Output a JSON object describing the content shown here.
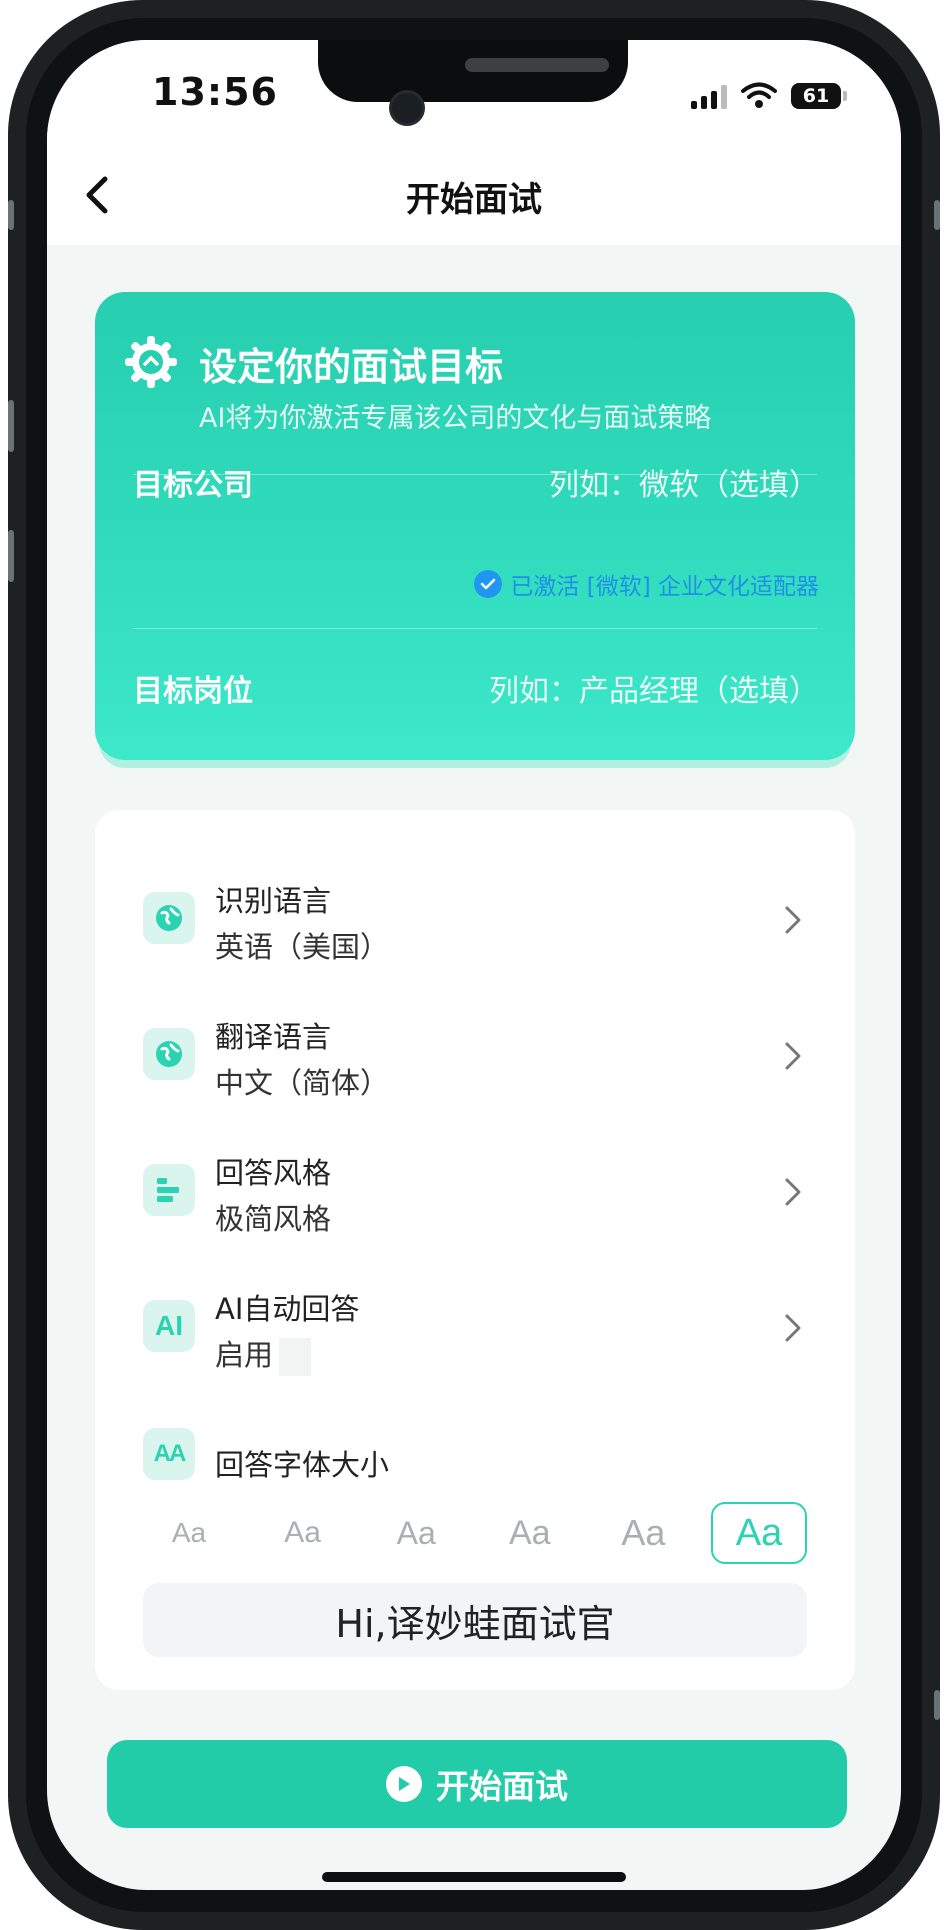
{
  "status_bar": {
    "time": "13:56",
    "battery": "61"
  },
  "nav": {
    "title": "开始面试"
  },
  "goal_card": {
    "title": "设定你的面试目标",
    "subtitle": "AI将为你激活专属该公司的文化与面试策略",
    "company_label": "目标公司",
    "company_placeholder": "列如：微软（选填）",
    "activated_text": "已激活 [微软] 企业文化适配器",
    "position_label": "目标岗位",
    "position_placeholder": "列如：产品经理（选填）"
  },
  "settings": {
    "items": [
      {
        "title": "识别语言",
        "value": "英语（美国）",
        "icon": "globe-icon"
      },
      {
        "title": "翻译语言",
        "value": "中文（简体）",
        "icon": "globe-icon"
      },
      {
        "title": "回答风格",
        "value": "极简风格",
        "icon": "bars-icon"
      },
      {
        "title": "AI自动回答",
        "value": "启用",
        "icon": "ai-icon",
        "icon_text": "AI"
      }
    ],
    "font_size": {
      "title": "回答字体大小",
      "icon_text": "AA",
      "options": [
        "Aa",
        "Aa",
        "Aa",
        "Aa",
        "Aa",
        "Aa"
      ],
      "selected_index": 5,
      "preview_text": "Hi,译妙蛙面试官"
    }
  },
  "start_button": {
    "label": "开始面试"
  },
  "colors": {
    "accent": "#22cca9",
    "activated": "#1f8fe8",
    "background": "#f2f6f5"
  }
}
